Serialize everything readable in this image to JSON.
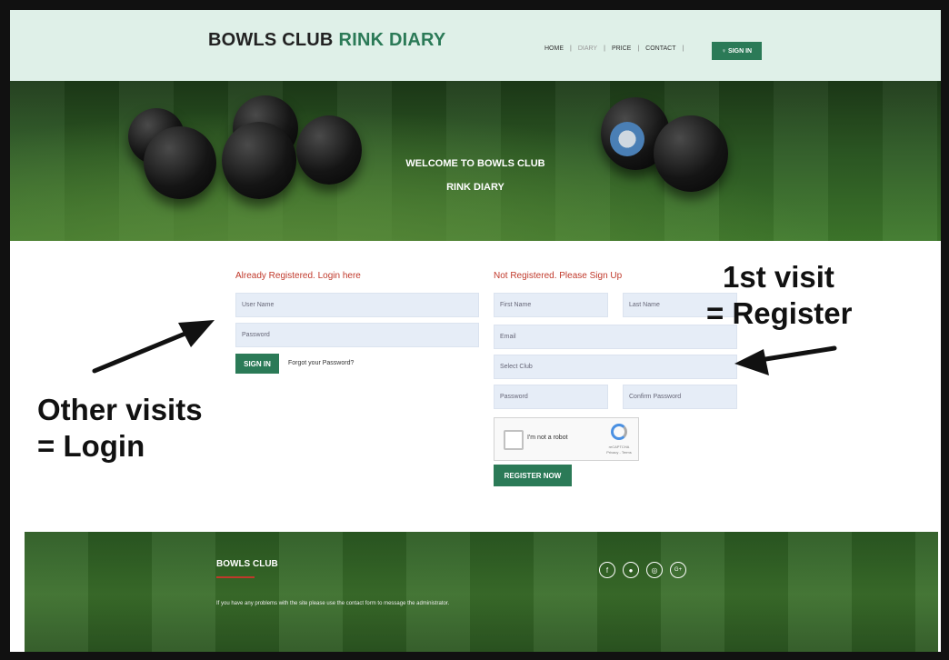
{
  "header": {
    "brand_part1": "BOWLS CLUB",
    "brand_part2": "RINK DIARY",
    "nav": [
      "HOME",
      "DIARY",
      "PRICE",
      "CONTACT"
    ],
    "nav_signin": "♀ SIGN IN"
  },
  "hero": {
    "title_line1": "WELCOME TO BOWLS CLUB",
    "title_line2": "RINK DIARY"
  },
  "login": {
    "title": "Already Registered. Login here",
    "username_placeholder": "User Name",
    "password_placeholder": "Password",
    "signin_button": "SIGN IN",
    "forgot_link": "Forgot your Password?"
  },
  "register": {
    "title": "Not Registered. Please Sign Up",
    "first_name_placeholder": "First Name",
    "last_name_placeholder": "Last Name",
    "email_placeholder": "Email",
    "club_placeholder": "Select Club",
    "password_placeholder": "Password",
    "confirm_password_placeholder": "Confirm Password",
    "captcha_label": "I'm not a robot",
    "captcha_small": "reCAPTCHA Privacy - Terms",
    "register_button": "REGISTER NOW"
  },
  "annotations": {
    "right_line1": "1st visit",
    "right_line2": "= Register",
    "left_line1": "Other visits",
    "left_line2": "= Login"
  },
  "footer": {
    "title": "BOWLS CLUB",
    "text": "If you have any problems with the site please use the contact form to message the administrator.",
    "social_icons": [
      "f",
      "●",
      "◎",
      "G+"
    ]
  },
  "colors": {
    "accent": "#2b7a57",
    "heading_red": "#c0392b",
    "topbar_bg": "#dff0e8",
    "input_bg": "#e6edf7"
  }
}
